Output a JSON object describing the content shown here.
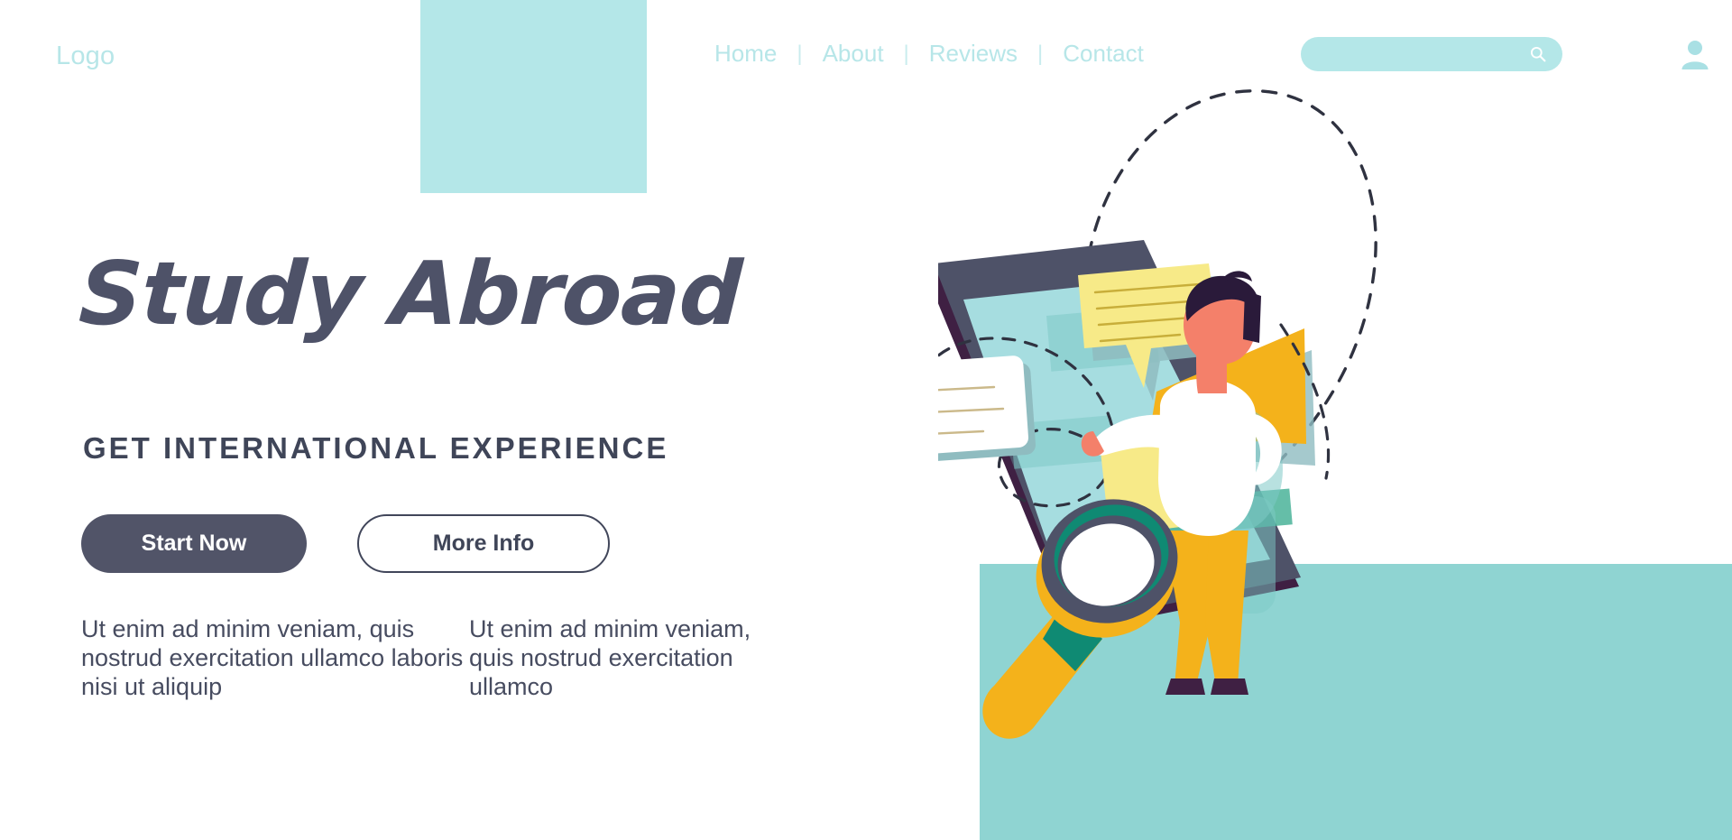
{
  "header": {
    "logo": "Logo",
    "nav_items": [
      {
        "label": "Home"
      },
      {
        "label": "About"
      },
      {
        "label": "Reviews"
      },
      {
        "label": "Contact"
      }
    ],
    "separator": "|",
    "search": {
      "value": "",
      "placeholder": "",
      "icon": "search-icon"
    },
    "account_icon": "user-icon"
  },
  "hero": {
    "title": "Study Abroad",
    "subtitle": "GET INTERNATIONAL EXPERIENCE",
    "primary_button": "Start Now",
    "secondary_button": "More Info",
    "paragraph_left": "Ut enim ad minim veniam, quis nostrud exercitation ullamco laboris nisi ut aliquip",
    "paragraph_right": "Ut enim ad minim veniam, quis nostrud exercitation ullamco"
  },
  "illustration": {
    "name": "study-abroad-tablet-illustration",
    "elements": [
      "tablet",
      "megaphone",
      "magnifier",
      "person",
      "speech-bubble-yellow",
      "note-card-white",
      "sticky-note-yellow",
      "dashed-path"
    ]
  },
  "colors": {
    "accent_teal": "#b4e7e8",
    "band_teal": "#8fd4d2",
    "screen_teal": "#a6dde0",
    "dark_slate": "#4e5268",
    "deep_purple": "#3f2043",
    "yellow": "#f4b21b",
    "yellow_light": "#f7ea88",
    "green": "#0f8a73",
    "skin": "#f4806a",
    "white": "#ffffff"
  }
}
